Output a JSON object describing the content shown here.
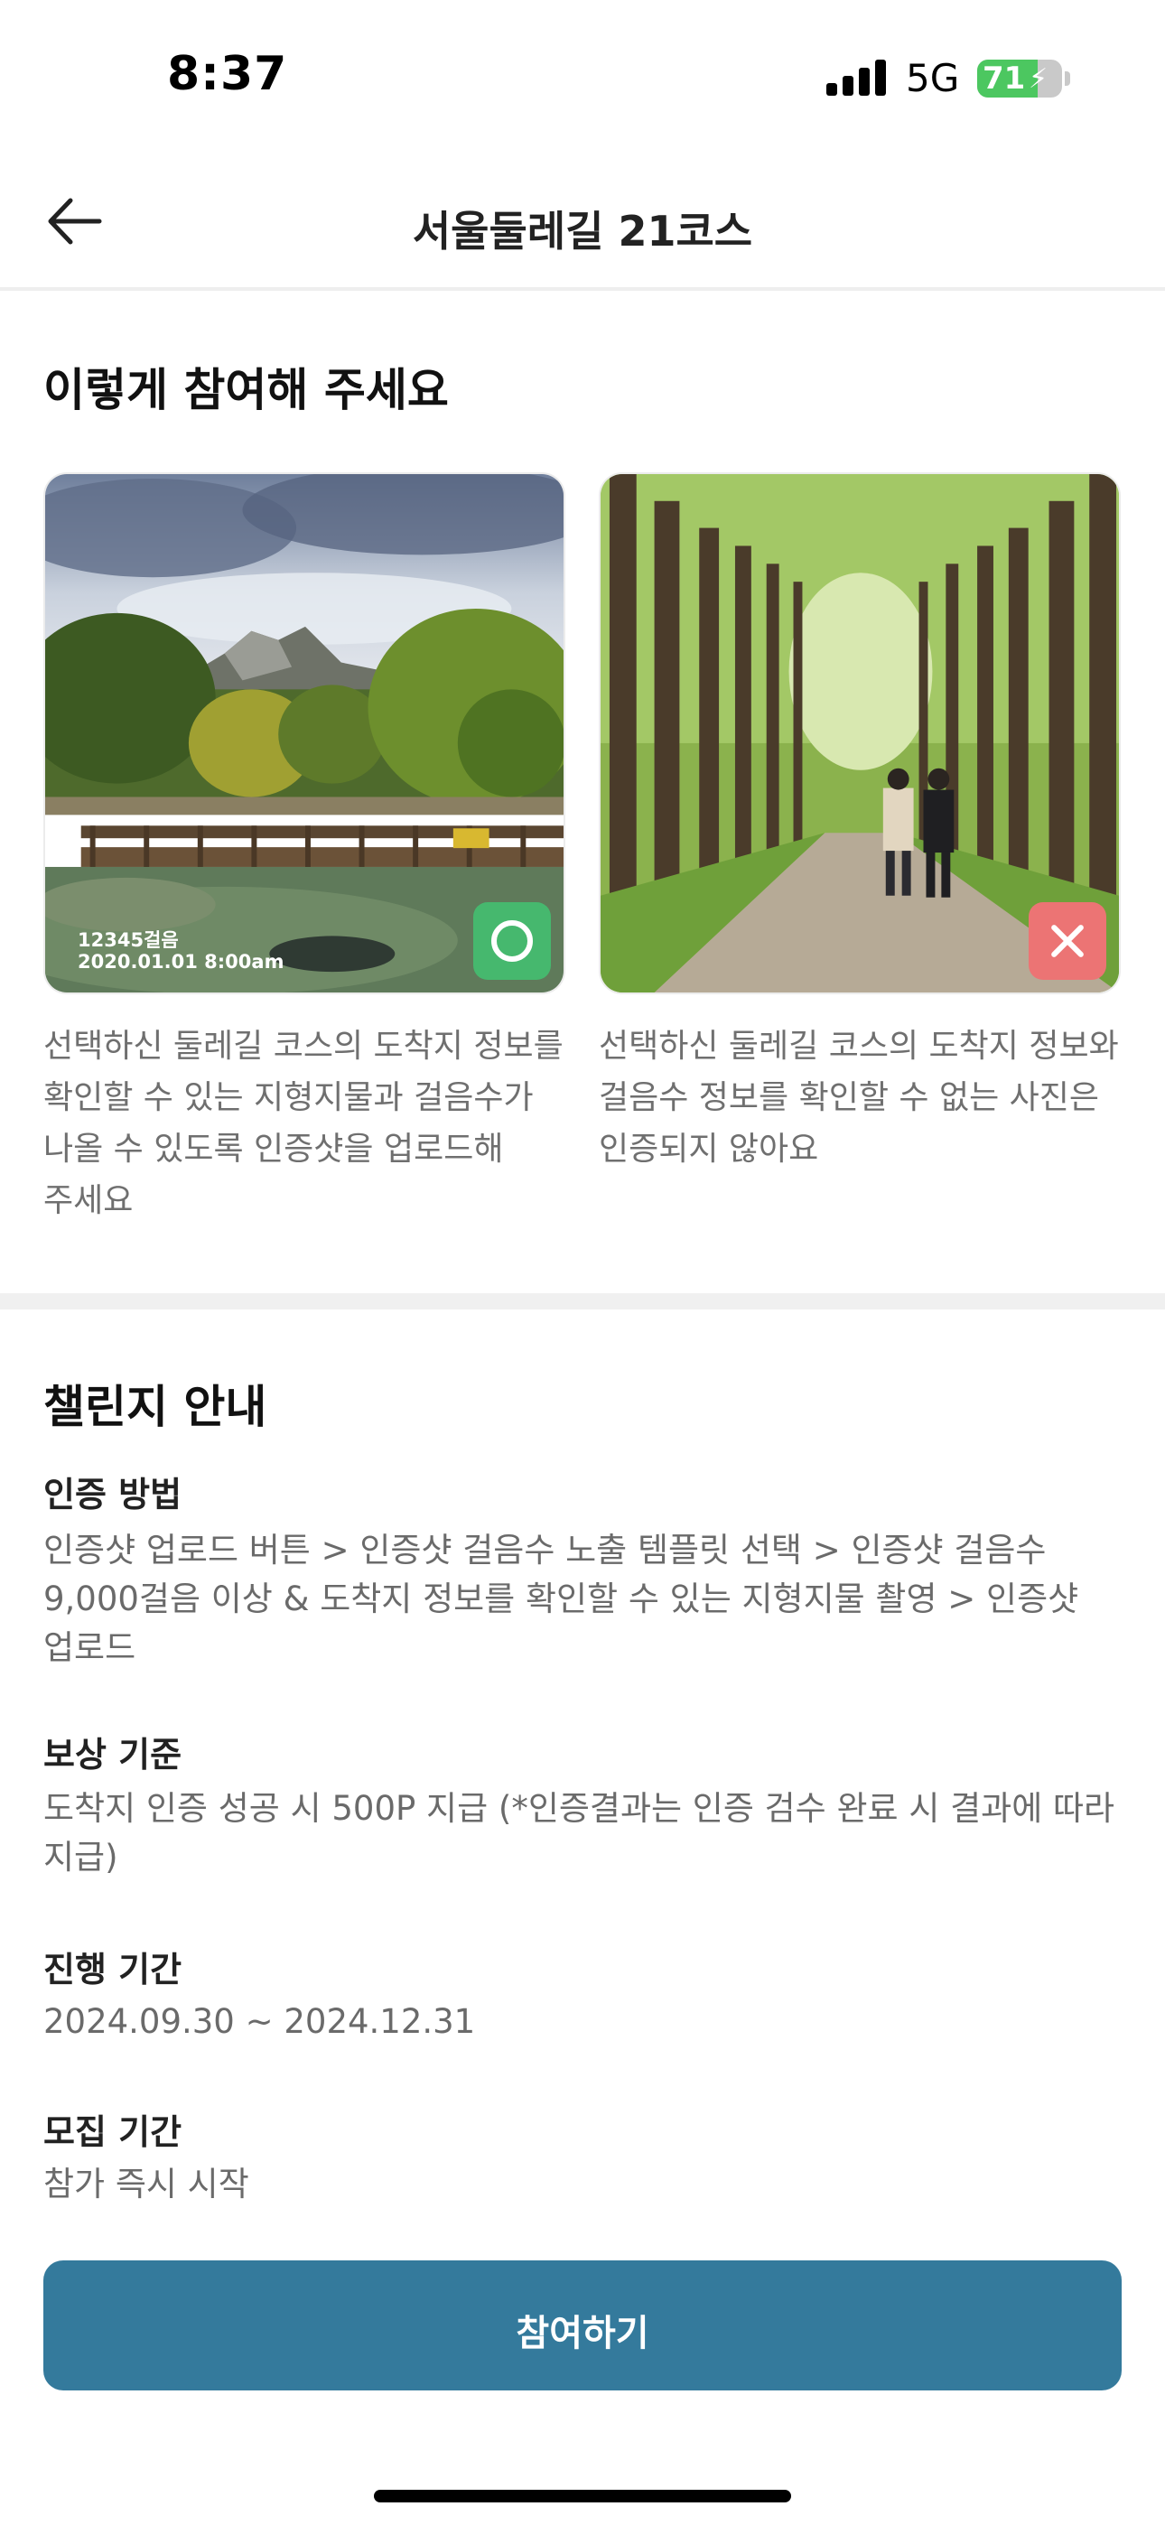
{
  "status_bar": {
    "time": "8:37",
    "network": "5G",
    "battery_level": "71",
    "battery_fraction": 0.71,
    "battery_color": "#4cc760"
  },
  "nav": {
    "back_icon": "arrow-left-icon",
    "title": "서울둘레길 21코스"
  },
  "how_to": {
    "title": "이렇게 참여해 주세요",
    "good_example": {
      "overlay_steps": "12345걸음",
      "overlay_datetime": "2020.01.01 8:00am",
      "badge_icon": "circle-ok-icon",
      "badge_color": "#46b86e",
      "caption": "선택하신 둘레길 코스의 도착지 정보를 확인할 수 있는 지형지물과 걸음수가 나올 수 있도록 인증샷을 업로드해 주세요"
    },
    "bad_example": {
      "badge_icon": "x-icon",
      "badge_color": "#ec7474",
      "caption": "선택하신 둘레길 코스의 도착지 정보와 걸음수 정보를 확인할 수 없는 사진은 인증되지 않아요"
    }
  },
  "challenge_info": {
    "title": "챌린지 안내",
    "method": {
      "label": "인증 방법",
      "value": "인증샷 업로드 버튼 > 인증샷 걸음수 노출 템플릿 선택 > 인증샷 걸음수 9,000걸음 이상 & 도착지 정보를 확인할 수 있는 지형지물 촬영 > 인증샷 업로드"
    },
    "reward": {
      "label": "보상 기준",
      "value": "도착지 인증 성공 시 500P 지급 (*인증결과는 인증 검수 완료 시 결과에 따라 지급)"
    },
    "period": {
      "label": "진행 기간",
      "value": "2024.09.30 ~ 2024.12.31"
    },
    "recruit": {
      "label": "모집 기간",
      "value": "참가 즉시 시작"
    }
  },
  "cta": {
    "label": "참여하기",
    "color": "#347a9c"
  }
}
